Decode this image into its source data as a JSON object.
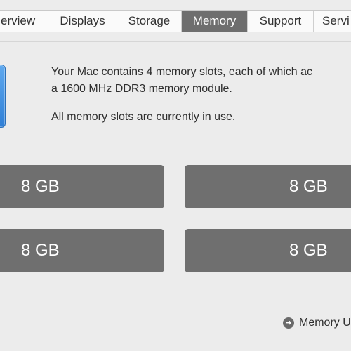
{
  "tabs": [
    {
      "label": "erview"
    },
    {
      "label": "Displays"
    },
    {
      "label": "Storage"
    },
    {
      "label": "Memory"
    },
    {
      "label": "Support"
    },
    {
      "label": "Servi"
    }
  ],
  "active_tab": "Memory",
  "info": {
    "line1": "Your Mac contains 4 memory slots, each of which ac",
    "line2": "a 1600 MHz DDR3 memory module.",
    "status": "All memory slots are currently in use."
  },
  "slots": [
    {
      "label": "8 GB"
    },
    {
      "label": "8 GB"
    },
    {
      "label": "8 GB"
    },
    {
      "label": "8 GB"
    }
  ],
  "link": {
    "label": "Memory U",
    "icon": "arrow-right-circle-icon"
  }
}
